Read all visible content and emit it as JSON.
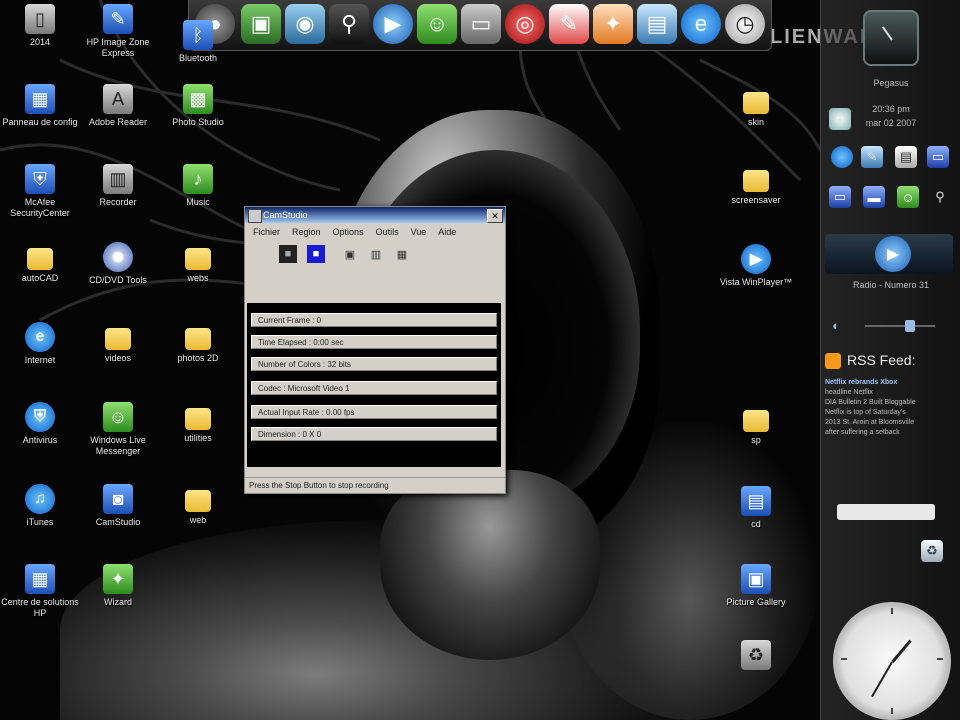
{
  "desktop": {
    "icons": [
      {
        "name": "kb-file",
        "label": "2014"
      },
      {
        "name": "image-app",
        "label": "HP Image Zone Express"
      },
      {
        "name": "bluetooth",
        "label": "Bluetooth"
      },
      {
        "name": "control-panel",
        "label": "Panneau de config"
      },
      {
        "name": "adobe-reader",
        "label": "Adobe Reader"
      },
      {
        "name": "photo-studio",
        "label": "Photo Studio"
      },
      {
        "name": "mcafee",
        "label": "McAfee SecurityCenter"
      },
      {
        "name": "recorder",
        "label": "Recorder"
      },
      {
        "name": "music",
        "label": "Music"
      },
      {
        "name": "folder-1",
        "label": "autoCAD"
      },
      {
        "name": "disk-app",
        "label": "CD/DVD Tools"
      },
      {
        "name": "folder-2",
        "label": "webs"
      },
      {
        "name": "internet",
        "label": "Internet"
      },
      {
        "name": "folder-3",
        "label": "videos"
      },
      {
        "name": "folder-4",
        "label": "photos 2D"
      },
      {
        "name": "antivirus",
        "label": "Antivirus"
      },
      {
        "name": "messenger",
        "label": "Windows Live Messenger"
      },
      {
        "name": "folder-5",
        "label": "utilities"
      },
      {
        "name": "itunes",
        "label": "iTunes"
      },
      {
        "name": "cam-studio",
        "label": "CamStudio"
      },
      {
        "name": "folder-6",
        "label": "web"
      },
      {
        "name": "hp-center",
        "label": "Centre de solutions HP"
      },
      {
        "name": "wizard",
        "label": "Wizard"
      },
      {
        "name": "folder-r1",
        "label": "skin"
      },
      {
        "name": "folder-r2",
        "label": "screensaver"
      },
      {
        "name": "media-player",
        "label": "Vista WinPlayer™"
      },
      {
        "name": "folder-r3",
        "label": "sp"
      },
      {
        "name": "doc-r",
        "label": "cd"
      },
      {
        "name": "photo-r",
        "label": "Picture Gallery"
      },
      {
        "name": "recycle-bin",
        "label": ""
      }
    ]
  },
  "wallpaper": {
    "logo": "LIENWAR"
  },
  "app_window": {
    "title": "CamStudio",
    "menus": [
      "Fichier",
      "Region",
      "Options",
      "Outils",
      "Vue",
      "Aide"
    ],
    "stats": [
      "Current Frame : 0",
      "Time Elapsed : 0:00 sec",
      "Number of Colors : 32 bits",
      "Codec : Microsoft Video 1",
      "Actual Input Rate : 0.00 fps",
      "Dimension : 0 X 0"
    ],
    "status": "Press the Stop Button to stop recording"
  },
  "sidebar": {
    "clock_label": "Pegasus",
    "time": "20:36 pm",
    "date": "mar 02 2007",
    "media_title": "Radio - Numero 31",
    "rss_title": "RSS Feed:",
    "rss_headline": "Netflix rebrands Xbox",
    "rss_lines": [
      "Netflix rebrands Xbox",
      "headline Netflix",
      "DIA Bulletin 2 Built Bloggable",
      "Netflix is top of Saturday's",
      "2013 St. Aroin at Bloomsville",
      "after suffering a setback"
    ]
  },
  "colors": {
    "accent": "#0a246a",
    "folder": "#e8b933",
    "rss": "#f59a1a"
  }
}
